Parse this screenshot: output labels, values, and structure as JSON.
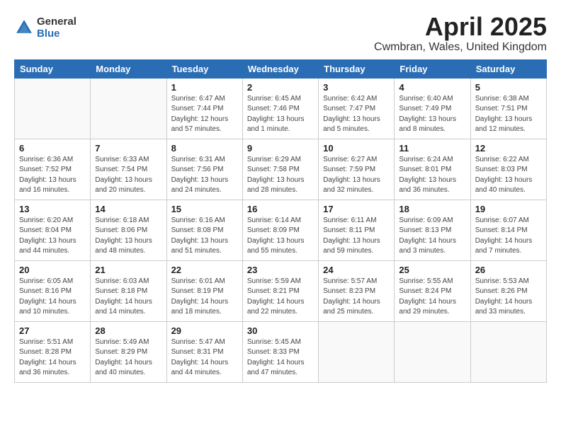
{
  "logo": {
    "line1": "General",
    "line2": "Blue"
  },
  "title": "April 2025",
  "subtitle": "Cwmbran, Wales, United Kingdom",
  "weekdays": [
    "Sunday",
    "Monday",
    "Tuesday",
    "Wednesday",
    "Thursday",
    "Friday",
    "Saturday"
  ],
  "weeks": [
    [
      {
        "day": "",
        "detail": ""
      },
      {
        "day": "",
        "detail": ""
      },
      {
        "day": "1",
        "detail": "Sunrise: 6:47 AM\nSunset: 7:44 PM\nDaylight: 12 hours and 57 minutes."
      },
      {
        "day": "2",
        "detail": "Sunrise: 6:45 AM\nSunset: 7:46 PM\nDaylight: 13 hours and 1 minute."
      },
      {
        "day": "3",
        "detail": "Sunrise: 6:42 AM\nSunset: 7:47 PM\nDaylight: 13 hours and 5 minutes."
      },
      {
        "day": "4",
        "detail": "Sunrise: 6:40 AM\nSunset: 7:49 PM\nDaylight: 13 hours and 8 minutes."
      },
      {
        "day": "5",
        "detail": "Sunrise: 6:38 AM\nSunset: 7:51 PM\nDaylight: 13 hours and 12 minutes."
      }
    ],
    [
      {
        "day": "6",
        "detail": "Sunrise: 6:36 AM\nSunset: 7:52 PM\nDaylight: 13 hours and 16 minutes."
      },
      {
        "day": "7",
        "detail": "Sunrise: 6:33 AM\nSunset: 7:54 PM\nDaylight: 13 hours and 20 minutes."
      },
      {
        "day": "8",
        "detail": "Sunrise: 6:31 AM\nSunset: 7:56 PM\nDaylight: 13 hours and 24 minutes."
      },
      {
        "day": "9",
        "detail": "Sunrise: 6:29 AM\nSunset: 7:58 PM\nDaylight: 13 hours and 28 minutes."
      },
      {
        "day": "10",
        "detail": "Sunrise: 6:27 AM\nSunset: 7:59 PM\nDaylight: 13 hours and 32 minutes."
      },
      {
        "day": "11",
        "detail": "Sunrise: 6:24 AM\nSunset: 8:01 PM\nDaylight: 13 hours and 36 minutes."
      },
      {
        "day": "12",
        "detail": "Sunrise: 6:22 AM\nSunset: 8:03 PM\nDaylight: 13 hours and 40 minutes."
      }
    ],
    [
      {
        "day": "13",
        "detail": "Sunrise: 6:20 AM\nSunset: 8:04 PM\nDaylight: 13 hours and 44 minutes."
      },
      {
        "day": "14",
        "detail": "Sunrise: 6:18 AM\nSunset: 8:06 PM\nDaylight: 13 hours and 48 minutes."
      },
      {
        "day": "15",
        "detail": "Sunrise: 6:16 AM\nSunset: 8:08 PM\nDaylight: 13 hours and 51 minutes."
      },
      {
        "day": "16",
        "detail": "Sunrise: 6:14 AM\nSunset: 8:09 PM\nDaylight: 13 hours and 55 minutes."
      },
      {
        "day": "17",
        "detail": "Sunrise: 6:11 AM\nSunset: 8:11 PM\nDaylight: 13 hours and 59 minutes."
      },
      {
        "day": "18",
        "detail": "Sunrise: 6:09 AM\nSunset: 8:13 PM\nDaylight: 14 hours and 3 minutes."
      },
      {
        "day": "19",
        "detail": "Sunrise: 6:07 AM\nSunset: 8:14 PM\nDaylight: 14 hours and 7 minutes."
      }
    ],
    [
      {
        "day": "20",
        "detail": "Sunrise: 6:05 AM\nSunset: 8:16 PM\nDaylight: 14 hours and 10 minutes."
      },
      {
        "day": "21",
        "detail": "Sunrise: 6:03 AM\nSunset: 8:18 PM\nDaylight: 14 hours and 14 minutes."
      },
      {
        "day": "22",
        "detail": "Sunrise: 6:01 AM\nSunset: 8:19 PM\nDaylight: 14 hours and 18 minutes."
      },
      {
        "day": "23",
        "detail": "Sunrise: 5:59 AM\nSunset: 8:21 PM\nDaylight: 14 hours and 22 minutes."
      },
      {
        "day": "24",
        "detail": "Sunrise: 5:57 AM\nSunset: 8:23 PM\nDaylight: 14 hours and 25 minutes."
      },
      {
        "day": "25",
        "detail": "Sunrise: 5:55 AM\nSunset: 8:24 PM\nDaylight: 14 hours and 29 minutes."
      },
      {
        "day": "26",
        "detail": "Sunrise: 5:53 AM\nSunset: 8:26 PM\nDaylight: 14 hours and 33 minutes."
      }
    ],
    [
      {
        "day": "27",
        "detail": "Sunrise: 5:51 AM\nSunset: 8:28 PM\nDaylight: 14 hours and 36 minutes."
      },
      {
        "day": "28",
        "detail": "Sunrise: 5:49 AM\nSunset: 8:29 PM\nDaylight: 14 hours and 40 minutes."
      },
      {
        "day": "29",
        "detail": "Sunrise: 5:47 AM\nSunset: 8:31 PM\nDaylight: 14 hours and 44 minutes."
      },
      {
        "day": "30",
        "detail": "Sunrise: 5:45 AM\nSunset: 8:33 PM\nDaylight: 14 hours and 47 minutes."
      },
      {
        "day": "",
        "detail": ""
      },
      {
        "day": "",
        "detail": ""
      },
      {
        "day": "",
        "detail": ""
      }
    ]
  ]
}
